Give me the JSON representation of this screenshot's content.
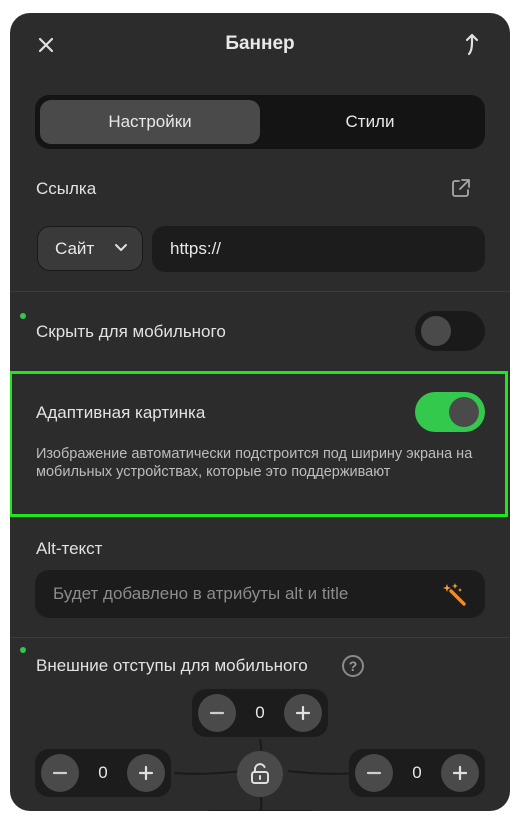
{
  "header": {
    "title": "Баннер"
  },
  "tabs": {
    "settings": "Настройки",
    "styles": "Стили"
  },
  "link": {
    "label": "Ссылка",
    "type_value": "Сайт",
    "url_value": "https://"
  },
  "hide_mobile": {
    "label": "Скрыть для мобильного",
    "enabled": false
  },
  "adaptive": {
    "label": "Адаптивная картинка",
    "enabled": true,
    "description": "Изображение автоматически подстроится под ширину экрана на мобильных устройствах, которые это поддерживают"
  },
  "alt": {
    "label": "Alt-текст",
    "placeholder": "Будет добавлено в атрибуты alt и title"
  },
  "margins": {
    "label": "Внешние отступы для мобильного",
    "help": "?",
    "top": "0",
    "left": "0",
    "right": "0"
  },
  "colors": {
    "accent_green": "#33c94c",
    "highlight": "#1ee81a",
    "panel": "#2c2c2c"
  },
  "icons": [
    "close-icon",
    "share-icon",
    "external-link-icon",
    "chevron-down-icon",
    "magic-wand-icon",
    "help-icon",
    "minus-icon",
    "plus-icon",
    "lock-icon"
  ]
}
